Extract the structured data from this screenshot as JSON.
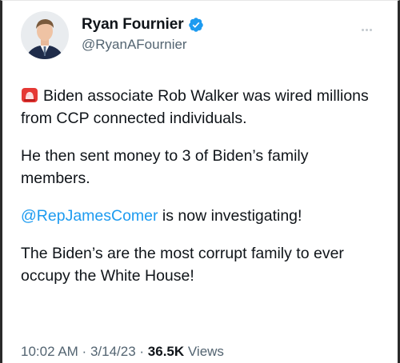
{
  "author": {
    "name": "Ryan Fournier",
    "handle": "@RyanAFournier",
    "verified_color": "#1d9bf0"
  },
  "icons": {
    "avatar": "profile-photo",
    "verified": "verified-badge-icon",
    "more": "more-options-icon",
    "siren": "police-siren-emoji-icon"
  },
  "tweet": {
    "line1_text": "Biden associate Rob Walker was wired millions from CCP connected individuals.",
    "line2_text": "He then sent money to 3 of Biden’s family members.",
    "line3_mention": "@RepJamesComer",
    "line3_text": " is now investigating!",
    "line4_text": "The Biden’s are the most corrupt family to ever occupy the White House!"
  },
  "meta": {
    "time": "10:02 AM",
    "sep1": " · ",
    "date": "3/14/23",
    "sep2": " · ",
    "views_count": "36.5K",
    "views_label": " Views"
  },
  "colors": {
    "text": "#0f1419",
    "secondary": "#536471",
    "link": "#1d9bf0"
  }
}
